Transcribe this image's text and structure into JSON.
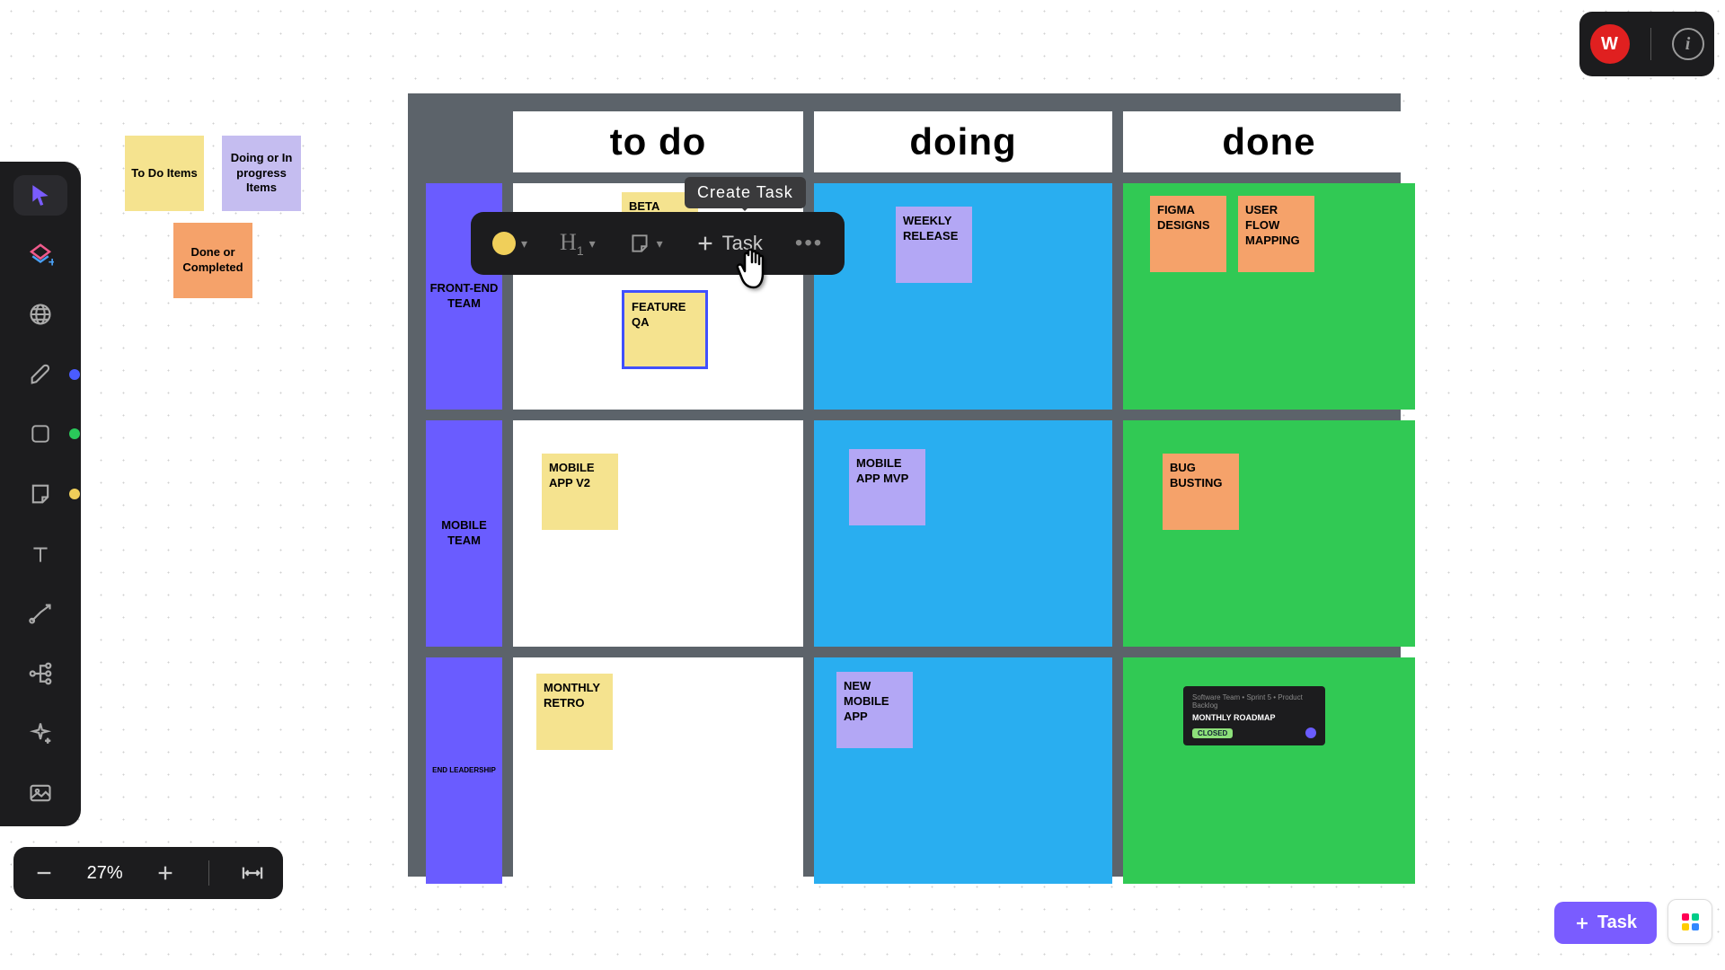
{
  "user": {
    "initial": "W"
  },
  "zoom": {
    "level": "27%"
  },
  "tooltip": {
    "create_task": "Create Task"
  },
  "ctx": {
    "task_label": "Task"
  },
  "bottom_right": {
    "task_label": "Task"
  },
  "columns": [
    "to do",
    "doing",
    "done"
  ],
  "rows": [
    "FRONT-END TEAM",
    "MOBILE TEAM",
    "END LEADERSHIP"
  ],
  "legend": {
    "todo": "To Do Items",
    "doing": "Doing or In progress Items",
    "done": "Done or Completed"
  },
  "cards": {
    "r0_todo": [
      {
        "text": "BETA LAUNCH",
        "color": "yellow"
      },
      {
        "text": "FEATURE QA",
        "color": "yellow",
        "selected": true
      }
    ],
    "r0_doing": [
      {
        "text": "WEEKLY RELEASE",
        "color": "lilac"
      }
    ],
    "r0_done": [
      {
        "text": "FIGMA DESIGNS",
        "color": "orange"
      },
      {
        "text": "USER FLOW MAPPING",
        "color": "orange"
      }
    ],
    "r1_todo": [
      {
        "text": "MOBILE APP V2",
        "color": "yellow"
      }
    ],
    "r1_doing": [
      {
        "text": "MOBILE APP MVP",
        "color": "lilac"
      }
    ],
    "r1_done": [
      {
        "text": "BUG BUSTING",
        "color": "orange"
      }
    ],
    "r2_todo": [
      {
        "text": "MONTHLY RETRO",
        "color": "yellow"
      }
    ],
    "r2_doing": [
      {
        "text": "NEW MOBILE APP",
        "color": "lilac"
      }
    ],
    "r2_done_card": {
      "tags": "Software Team • Sprint 5 • Product Backlog",
      "title": "MONTHLY ROADMAP",
      "status": "CLOSED"
    }
  }
}
